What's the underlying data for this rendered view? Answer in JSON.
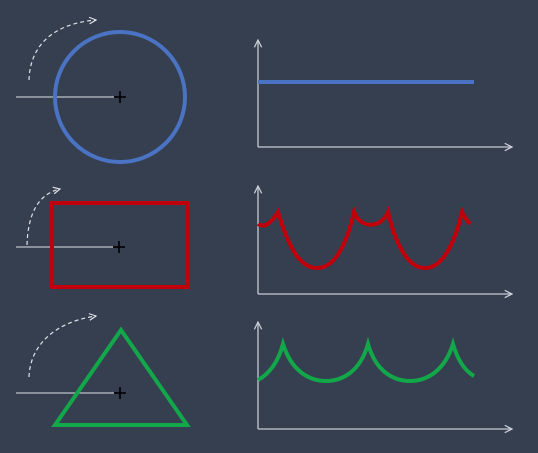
{
  "background": "#353f50",
  "axis_color": "#c7cbd2",
  "guide_color": "#dfe2e7",
  "rows": [
    {
      "shape": "circle",
      "color": "#4a73c4",
      "rotation_arrow_icon": "dashed-curved-arrow-icon",
      "center_marker_icon": "crosshair-icon",
      "profile": "constant-line"
    },
    {
      "shape": "rectangle",
      "color": "#c0000a",
      "rotation_arrow_icon": "dashed-curved-arrow-icon",
      "center_marker_icon": "crosshair-icon",
      "profile": "periodic-bumps-with-dips"
    },
    {
      "shape": "triangle",
      "color": "#12a84a",
      "rotation_arrow_icon": "dashed-curved-arrow-icon",
      "center_marker_icon": "crosshair-icon",
      "profile": "periodic-cusped-arches"
    }
  ]
}
